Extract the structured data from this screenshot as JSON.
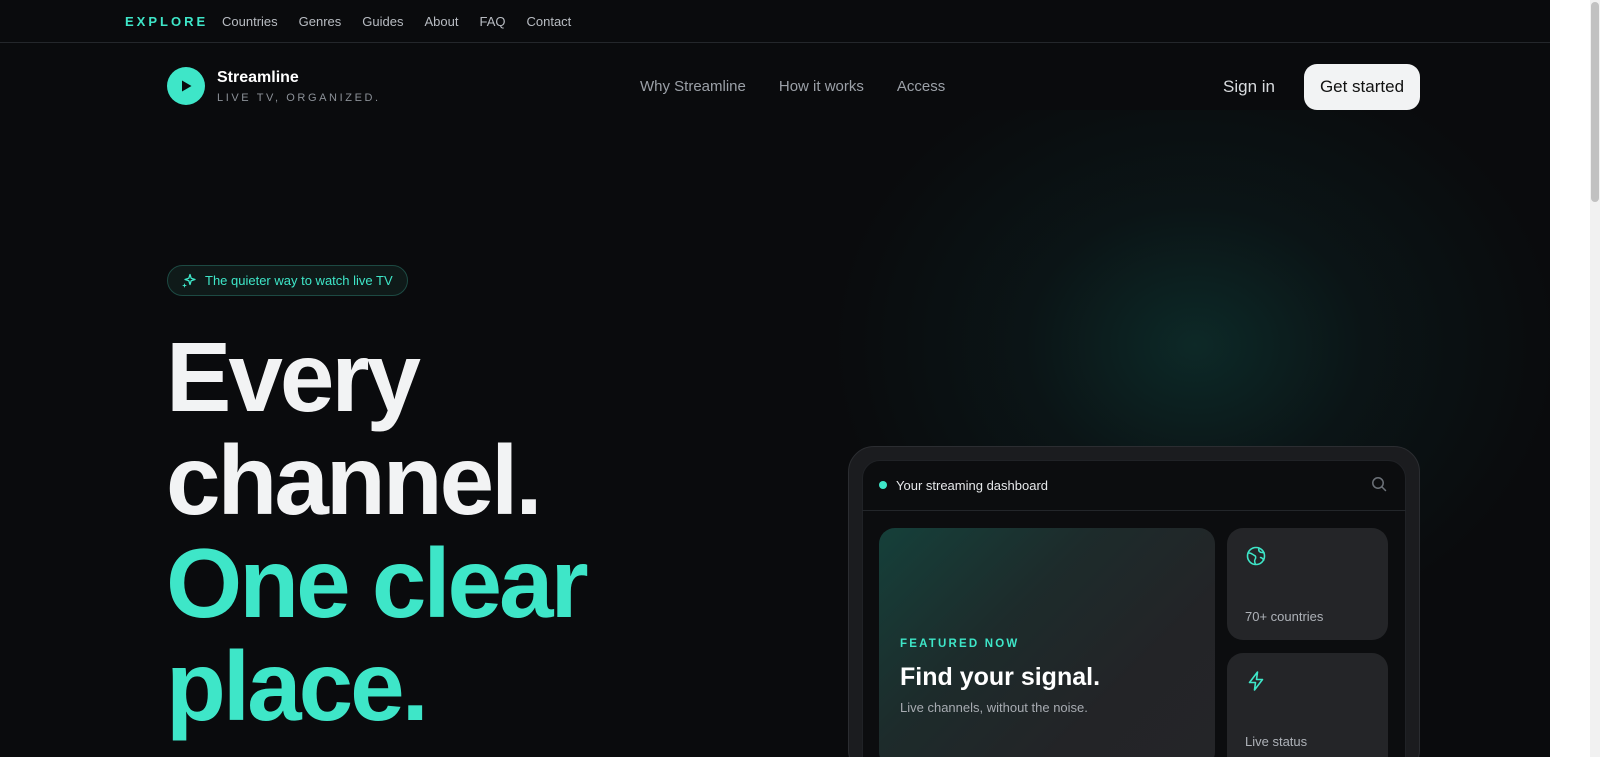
{
  "topbar": {
    "brand": "EXPLORE",
    "links": [
      "Countries",
      "Genres",
      "Guides",
      "About",
      "FAQ",
      "Contact"
    ]
  },
  "nav": {
    "logo_name": "Streamline",
    "logo_tagline": "LIVE TV, ORGANIZED.",
    "links": [
      "Why Streamline",
      "How it works",
      "Access"
    ],
    "sign_in": "Sign in",
    "cta": "Get started"
  },
  "hero": {
    "pill": "The quieter way to watch live TV",
    "line1": "Every",
    "line2": "channel.",
    "line3": "One clear",
    "line4": "place."
  },
  "dashboard": {
    "title": "Your streaming dashboard",
    "featured_label": "FEATURED NOW",
    "featured_title": "Find your signal.",
    "featured_sub": "Live channels, without the noise.",
    "card1_text": "70+ countries",
    "card2_text": "Live status"
  },
  "colors": {
    "accent": "#3ee6c8",
    "background": "#0a0b0d",
    "card": "#242528"
  },
  "icons": {
    "logo": "play-icon",
    "pill": "sparkles-icon",
    "search": "search-icon",
    "card1": "globe-icon",
    "card2": "lightning-icon"
  }
}
